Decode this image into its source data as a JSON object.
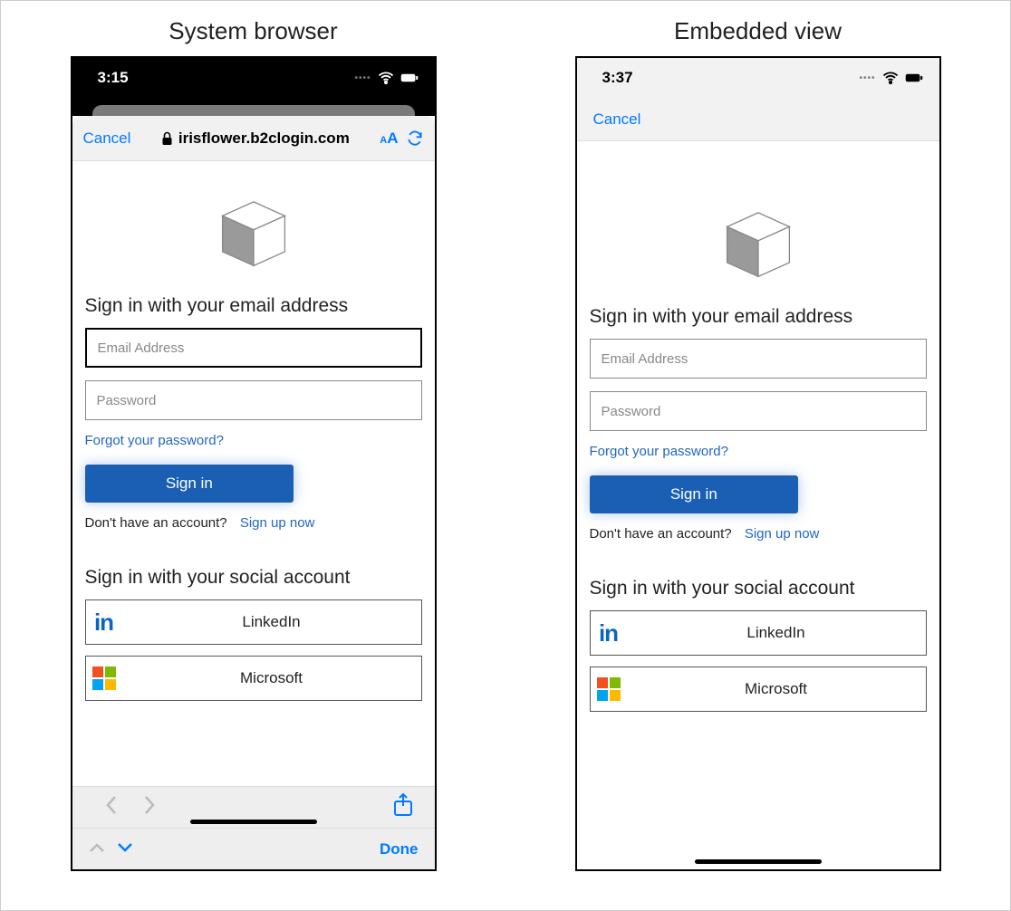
{
  "labels": {
    "system_browser": "System browser",
    "embedded_view": "Embedded view"
  },
  "left": {
    "status_time": "3:15",
    "url_cancel": "Cancel",
    "url_host": "irisflower.b2clogin.com",
    "toolbar_done": "Done"
  },
  "right": {
    "status_time": "3:37",
    "nav_cancel": "Cancel"
  },
  "signin": {
    "heading": "Sign in with your email address",
    "email_placeholder": "Email Address",
    "password_placeholder": "Password",
    "forgot": "Forgot your password?",
    "signin_btn": "Sign in",
    "no_account": "Don't have an account?",
    "signup_link": "Sign up now",
    "social_heading": "Sign in with your social account",
    "linkedin": "LinkedIn",
    "microsoft": "Microsoft"
  }
}
